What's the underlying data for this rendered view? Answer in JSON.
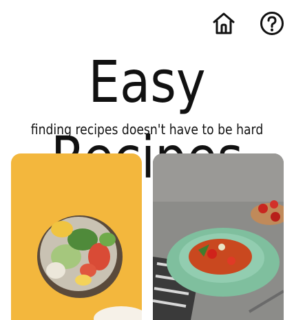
{
  "header": {
    "home_icon": "home-icon",
    "help_icon": "help-circle-icon"
  },
  "hero": {
    "title": "Easy Recipes",
    "subtitle": "finding recipes doesn't have to be hard"
  },
  "cards": [
    {
      "image": "poke-bowl-photo",
      "background": "#F4B63C"
    },
    {
      "image": "pasta-plate-photo",
      "background": "#8E8E8C"
    }
  ]
}
